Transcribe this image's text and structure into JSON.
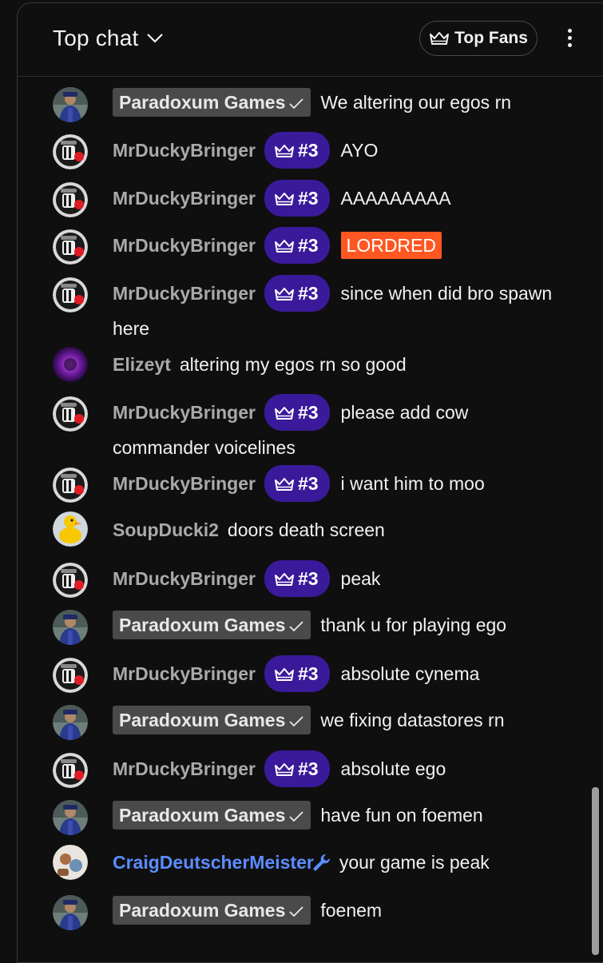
{
  "header": {
    "title": "Top chat",
    "top_fans_label": "Top Fans"
  },
  "colors": {
    "background": "#0f0f0f",
    "owner_chip": "#4a4a4a",
    "fan_badge": "#3a1a9a",
    "moderator_name": "#5b8cff",
    "highlight_tag": "#ff5722"
  },
  "messages": [
    {
      "author": "Paradoxum Games",
      "role": "owner",
      "text": "We altering our egos rn",
      "avatar": "paradoxum-avatar"
    },
    {
      "author": "MrDuckyBringer",
      "role": "fan",
      "badge": "#3",
      "text": "AYO",
      "avatar": "ducky-avatar"
    },
    {
      "author": "MrDuckyBringer",
      "role": "fan",
      "badge": "#3",
      "text": "AAAAAAAAA",
      "avatar": "ducky-avatar"
    },
    {
      "author": "MrDuckyBringer",
      "role": "fan",
      "badge": "#3",
      "text": "LORDRED",
      "highlight": true,
      "avatar": "ducky-avatar"
    },
    {
      "author": "MrDuckyBringer",
      "role": "fan",
      "badge": "#3",
      "text": "since when did bro spawn here",
      "avatar": "ducky-avatar"
    },
    {
      "author": "Elizeyt",
      "role": "viewer",
      "text": "altering my egos rn so good",
      "avatar": "elizeyt-avatar"
    },
    {
      "author": "MrDuckyBringer",
      "role": "fan",
      "badge": "#3",
      "text": "please add cow commander voicelines",
      "avatar": "ducky-avatar"
    },
    {
      "author": "MrDuckyBringer",
      "role": "fan",
      "badge": "#3",
      "text": "i want him to moo",
      "avatar": "ducky-avatar"
    },
    {
      "author": "SoupDucki2",
      "role": "viewer",
      "text": "doors death screen",
      "avatar": "soupducki-avatar"
    },
    {
      "author": "MrDuckyBringer",
      "role": "fan",
      "badge": "#3",
      "text": "peak",
      "avatar": "ducky-avatar"
    },
    {
      "author": "Paradoxum Games",
      "role": "owner",
      "text": "thank u for playing ego",
      "avatar": "paradoxum-avatar"
    },
    {
      "author": "MrDuckyBringer",
      "role": "fan",
      "badge": "#3",
      "text": "absolute cynema",
      "avatar": "ducky-avatar"
    },
    {
      "author": "Paradoxum Games",
      "role": "owner",
      "text": "we fixing datastores rn",
      "avatar": "paradoxum-avatar"
    },
    {
      "author": "MrDuckyBringer",
      "role": "fan",
      "badge": "#3",
      "text": "absolute ego",
      "avatar": "ducky-avatar"
    },
    {
      "author": "Paradoxum Games",
      "role": "owner",
      "text": "have fun on foemen",
      "avatar": "paradoxum-avatar"
    },
    {
      "author": "CraigDeutscherMeister",
      "role": "moderator",
      "text": "your game is peak",
      "avatar": "craig-avatar"
    },
    {
      "author": "Paradoxum Games",
      "role": "owner",
      "text": "foenem",
      "avatar": "paradoxum-avatar"
    }
  ]
}
